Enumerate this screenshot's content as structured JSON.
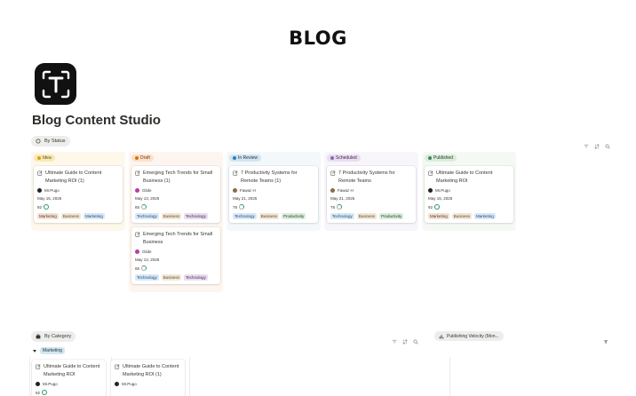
{
  "header": {
    "title": "BLOG"
  },
  "page": {
    "title": "Blog Content Studio"
  },
  "status_view": {
    "tab_label": "By Status"
  },
  "columns": [
    {
      "label": "Idea",
      "pill_bg": "#f9e8b8",
      "pill_fg": "#5c4b13",
      "dot": "#d9a21b",
      "col_bg": "#fdf8ea",
      "cards": [
        {
          "title": "Ultimate Guide to Content Marketing ROI (1)",
          "author": "Mr.Pugo",
          "avatar": "#222",
          "date": "May 15, 2025",
          "score": "92",
          "ring": "full",
          "tags": [
            {
              "label": "Marketing",
              "cls": "marketing"
            },
            {
              "label": "Business",
              "cls": "business"
            },
            {
              "label": "Marketing",
              "cls": "mkt2"
            }
          ]
        }
      ]
    },
    {
      "label": "Draft",
      "pill_bg": "#fbe0cc",
      "pill_fg": "#6b3a17",
      "dot": "#d9730d",
      "col_bg": "#fdf5ef",
      "cards": [
        {
          "title": "Emerging Tech Trends for Small Business (1)",
          "author": "Glide",
          "avatar": "#b63da6",
          "date": "May 13, 2025",
          "score": "65",
          "ring": "half",
          "tags": [
            {
              "label": "Technology",
              "cls": "technology"
            },
            {
              "label": "Business",
              "cls": "business"
            },
            {
              "label": "Technology",
              "cls": "tech2"
            }
          ]
        },
        {
          "title": "Emerging Tech Trends for Small Business",
          "author": "Glide",
          "avatar": "#b63da6",
          "date": "May 13, 2025",
          "score": "65",
          "ring": "half",
          "tags": [
            {
              "label": "Technology",
              "cls": "technology"
            },
            {
              "label": "Business",
              "cls": "business"
            },
            {
              "label": "Technology",
              "cls": "tech2"
            }
          ]
        }
      ]
    },
    {
      "label": "In Review",
      "pill_bg": "#d3e5ef",
      "pill_fg": "#183347",
      "dot": "#2e7bbf",
      "col_bg": "#f3f8fb",
      "cards": [
        {
          "title": "7 Productivity Systems for Remote Teams (1)",
          "author": "Fawaz H",
          "avatar": "#8a6a4a",
          "date": "May 21, 2025",
          "score": "78",
          "ring": "half",
          "tags": [
            {
              "label": "Technology",
              "cls": "technology"
            },
            {
              "label": "Business",
              "cls": "business"
            },
            {
              "label": "Productivity",
              "cls": "productivity"
            }
          ]
        }
      ]
    },
    {
      "label": "Scheduled",
      "pill_bg": "#e8deee",
      "pill_fg": "#412454",
      "dot": "#9065b0",
      "col_bg": "#f8f5fb",
      "cards": [
        {
          "title": "7 Productivity Systems for Remote Teams",
          "author": "Fawaz H",
          "avatar": "#8a6a4a",
          "date": "May 21, 2025",
          "score": "78",
          "ring": "half",
          "tags": [
            {
              "label": "Technology",
              "cls": "technology"
            },
            {
              "label": "Business",
              "cls": "business"
            },
            {
              "label": "Productivity",
              "cls": "productivity"
            }
          ]
        }
      ]
    },
    {
      "label": "Published",
      "pill_bg": "#dbeddb",
      "pill_fg": "#1c3829",
      "dot": "#448361",
      "col_bg": "#f4f9f4",
      "cards": [
        {
          "title": "Ultimate Guide to Content Marketing ROI",
          "author": "Mr.Pugo",
          "avatar": "#222",
          "date": "May 15, 2025",
          "score": "92",
          "ring": "full",
          "tags": [
            {
              "label": "Marketing",
              "cls": "marketing"
            },
            {
              "label": "Business",
              "cls": "business"
            },
            {
              "label": "Marketing",
              "cls": "mkt2"
            }
          ]
        }
      ]
    }
  ],
  "category_view": {
    "tab_label": "By Category",
    "group_label": "Marketing"
  },
  "category_cards": [
    {
      "title": "Ultimate Guide to Content Marketing ROI",
      "author": "Mr.Pugo",
      "score": "92"
    },
    {
      "title": "Ultimate Guide to Content Marketing ROI (1)",
      "author": "Mr.Pugo"
    }
  ],
  "chart_view": {
    "tab_label": "Publishing Velocity (Mon..."
  },
  "icons": [
    "filter-icon",
    "sort-icon",
    "search-icon",
    "document-icon",
    "chart-icon"
  ]
}
